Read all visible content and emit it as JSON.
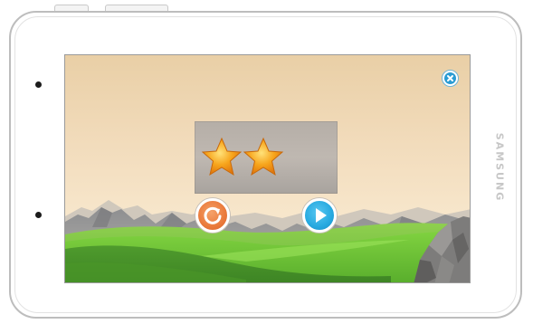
{
  "device": {
    "brand_label": "SAMSUNG"
  },
  "game": {
    "stars_earned": 2,
    "colors": {
      "star": "#f7a51c",
      "replay_button": "#ea7a3b",
      "play_button": "#26a9e0",
      "close_button": "#2b9cd3",
      "grass": "#6cc53d",
      "sky": "#f2dcbc"
    },
    "icons": {
      "close": "close-icon",
      "replay": "replay-icon",
      "play": "play-icon",
      "star": "star-icon"
    }
  }
}
